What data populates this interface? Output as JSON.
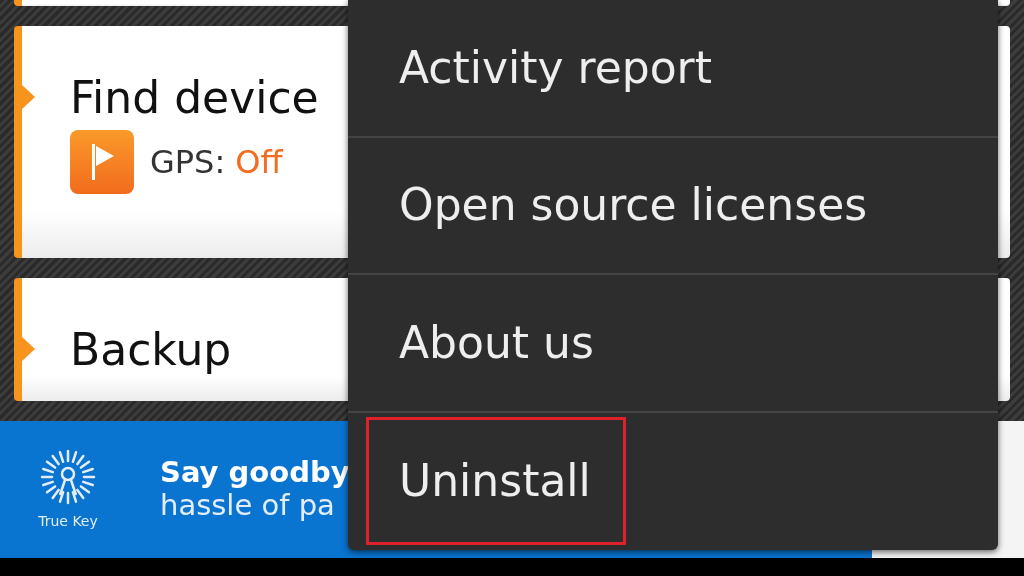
{
  "cards": [
    {
      "title": "Find device",
      "status_label": "GPS:",
      "status_value": "Off"
    },
    {
      "title": "Backup"
    }
  ],
  "menu": {
    "items": [
      {
        "label": "Activity report",
        "highlighted": false
      },
      {
        "label": "Open source licenses",
        "highlighted": false
      },
      {
        "label": "About us",
        "highlighted": false
      },
      {
        "label": "Uninstall",
        "highlighted": true
      }
    ]
  },
  "banner": {
    "brand": "True Key",
    "headline": "Say goodby",
    "subline": "hassle of pa"
  }
}
